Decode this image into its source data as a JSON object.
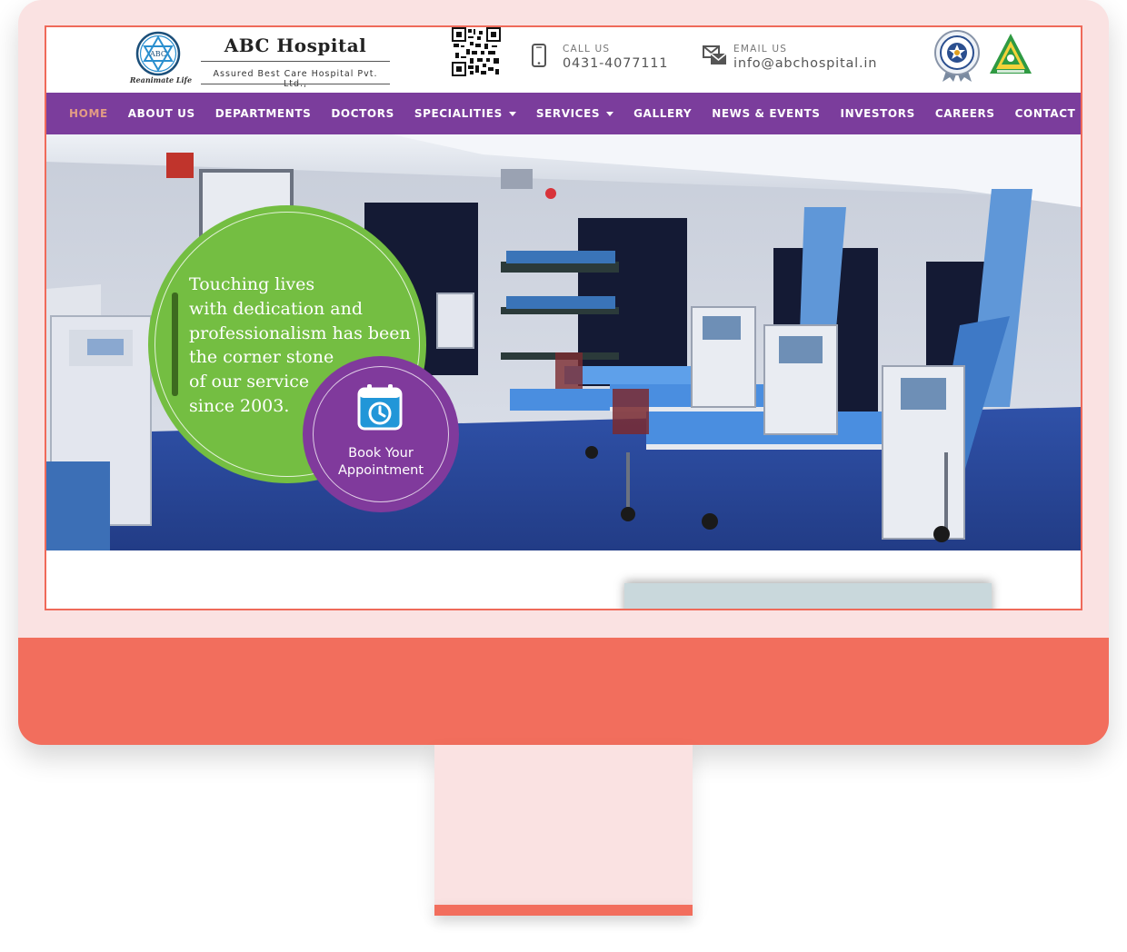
{
  "colors": {
    "frame": "#fae2e2",
    "accent": "#f26e5d",
    "nav_bg": "#7b3d9c",
    "nav_active": "#e39c84",
    "green": "#74be42",
    "purple": "#803a9c"
  },
  "header": {
    "logo_emblem_text": "ABC",
    "logo_tagline": "Reanimate Life",
    "brand_name": "ABC Hospital",
    "brand_sub": "Assured Best Care Hospital Pvt. Ltd.,",
    "qr_icon": "qr-code-icon",
    "call": {
      "icon": "mobile-phone-icon",
      "label": "CALL US",
      "value": "0431-4077111"
    },
    "email": {
      "icon": "email-envelope-icon",
      "label": "EMAIL US",
      "value": "info@abchospital.in"
    },
    "badges": [
      "accreditation-seal-icon",
      "accreditation-triangle-icon"
    ]
  },
  "nav": {
    "items": [
      {
        "label": "HOME",
        "active": true
      },
      {
        "label": "ABOUT US"
      },
      {
        "label": "DEPARTMENTS"
      },
      {
        "label": "DOCTORS"
      },
      {
        "label": "SPECIALITIES",
        "dropdown": true
      },
      {
        "label": "SERVICES",
        "dropdown": true
      },
      {
        "label": "GALLERY"
      },
      {
        "label": "NEWS & EVENTS"
      },
      {
        "label": "INVESTORS"
      },
      {
        "label": "CAREERS"
      },
      {
        "label": "CONTACT US"
      }
    ]
  },
  "hero": {
    "lines": [
      "Touching lives",
      "with dedication and",
      "professionalism has been",
      "the corner stone",
      "of our service",
      "since 2003."
    ],
    "appointment": {
      "icon": "calendar-clock-icon",
      "line1": "Book Your",
      "line2": "Appointment"
    }
  }
}
